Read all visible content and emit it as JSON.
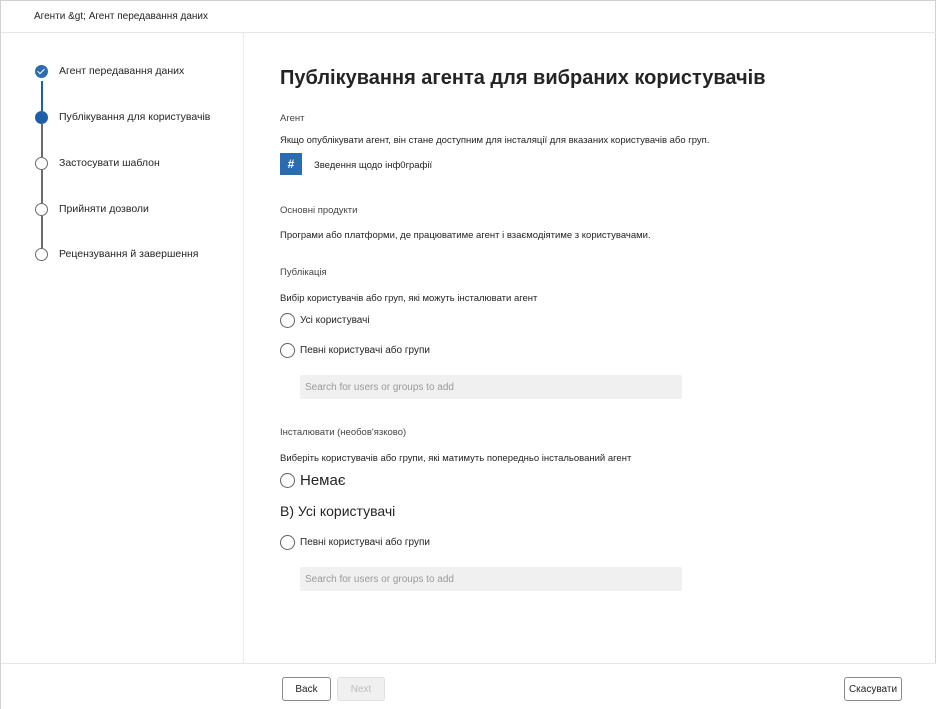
{
  "breadcrumb": "Агенти &gt; Агент передавання даних",
  "steps": [
    {
      "label": "Агент передавання даних",
      "state": "done"
    },
    {
      "label": "Публікування для користувачів",
      "state": "current"
    },
    {
      "label": "Застосувати шаблон",
      "state": "todo"
    },
    {
      "label": "Прийняти дозволи",
      "state": "todo"
    },
    {
      "label": "Рецензування й завершення",
      "state": "todo"
    }
  ],
  "main": {
    "title": "Публікування агента для вибраних користувачів",
    "agent_section_label": "Агент",
    "agent_description": "Якщо опублікувати агент, він стане доступним для інсталяції для вказаних користувачів або груп.",
    "agent_icon": "#",
    "agent_name": "Зведення щодо інф0графії",
    "products_label": "Основні продукти",
    "products_description": "Програми або платформи, де працюватиме агент і взаємодіятиме з користувачами.",
    "publication_label": "Публікація",
    "publication_description": "Вибір користувачів або груп, які можуть інсталювати агент",
    "publication_options": [
      "Усі користувачі",
      "Певні користувачі або групи"
    ],
    "search_placeholder": "Search for users or groups to add",
    "install_label": "Інсталювати (необов'язково)",
    "install_description": "Виберіть користувачів або групи, які матимуть попередньо інстальований агент",
    "install_option_none": "Немає",
    "install_heading_b": "B) Усі користувачі",
    "install_option_specific": "Певні користувачі або групи",
    "install_search_placeholder": "Search for users or groups to add"
  },
  "footer": {
    "back_label": "Back",
    "next_label": "Next",
    "cancel_label": "Скасувати"
  },
  "colors": {
    "accent": "#1f5fa8",
    "accent_light": "#2b6cb0"
  }
}
